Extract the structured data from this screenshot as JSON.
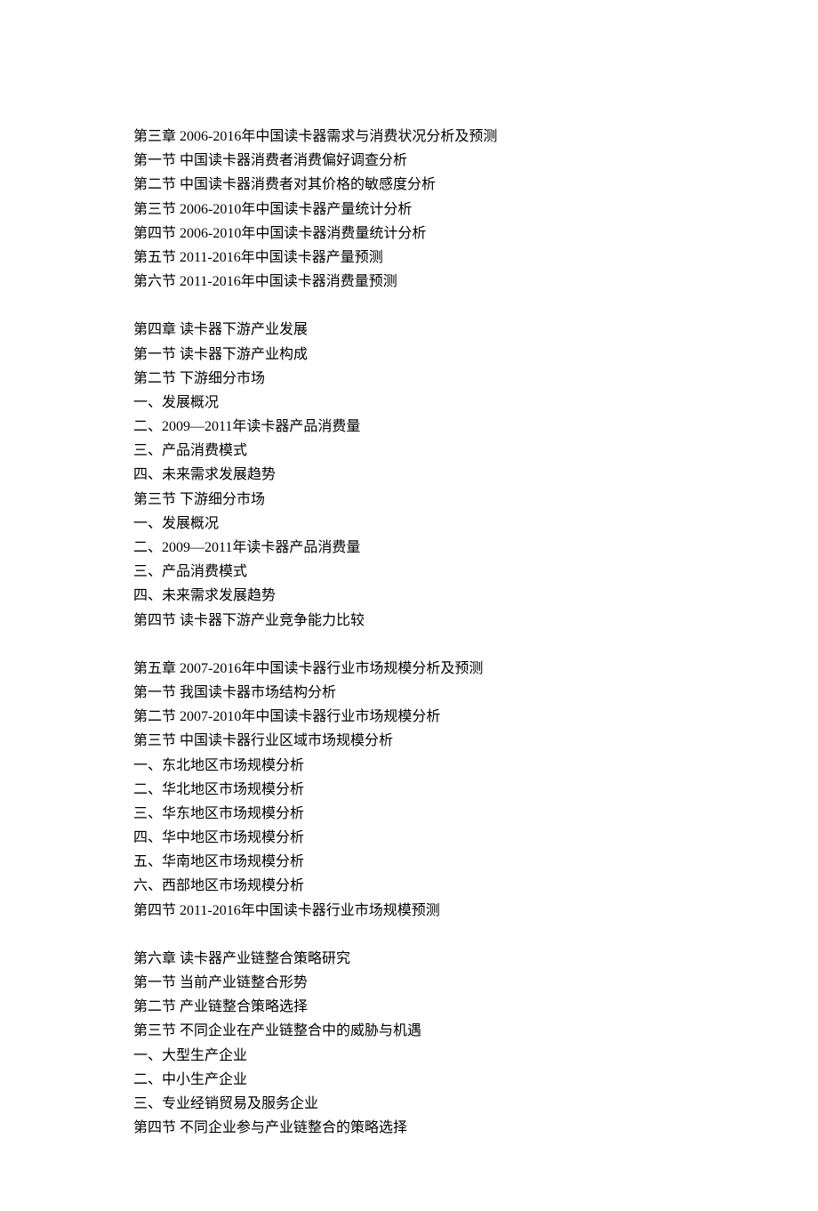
{
  "chapter3": {
    "title": "第三章  2006-2016年中国读卡器需求与消费状况分析及预测",
    "sections": [
      "第一节  中国读卡器消费者消费偏好调查分析",
      "第二节  中国读卡器消费者对其价格的敏感度分析",
      "第三节  2006-2010年中国读卡器产量统计分析",
      "第四节  2006-2010年中国读卡器消费量统计分析",
      "第五节  2011-2016年中国读卡器产量预测",
      "第六节  2011-2016年中国读卡器消费量预测"
    ]
  },
  "chapter4": {
    "title": "第四章  读卡器下游产业发展",
    "s1": "第一节  读卡器下游产业构成",
    "s2": "第二节  下游细分市场",
    "s2_items": [
      "一、发展概况",
      "二、2009—2011年读卡器产品消费量",
      "三、产品消费模式",
      "四、未来需求发展趋势"
    ],
    "s3": "第三节  下游细分市场",
    "s3_items": [
      "一、发展概况",
      "二、2009—2011年读卡器产品消费量",
      "三、产品消费模式",
      "四、未来需求发展趋势"
    ],
    "s4": "第四节  读卡器下游产业竞争能力比较"
  },
  "chapter5": {
    "title": "第五章  2007-2016年中国读卡器行业市场规模分析及预测",
    "s1": "第一节  我国读卡器市场结构分析",
    "s2": "第二节  2007-2010年中国读卡器行业市场规模分析",
    "s3": "第三节  中国读卡器行业区域市场规模分析",
    "s3_items": [
      "一、东北地区市场规模分析",
      "二、华北地区市场规模分析",
      "三、华东地区市场规模分析",
      "四、华中地区市场规模分析",
      "五、华南地区市场规模分析",
      "六、西部地区市场规模分析"
    ],
    "s4": "第四节  2011-2016年中国读卡器行业市场规模预测"
  },
  "chapter6": {
    "title": "第六章  读卡器产业链整合策略研究",
    "s1": "第一节  当前产业链整合形势",
    "s2": "第二节  产业链整合策略选择",
    "s3": "第三节  不同企业在产业链整合中的威胁与机遇",
    "s3_items": [
      "一、大型生产企业",
      "二、中小生产企业",
      "三、专业经销贸易及服务企业"
    ],
    "s4": "第四节  不同企业参与产业链整合的策略选择"
  }
}
